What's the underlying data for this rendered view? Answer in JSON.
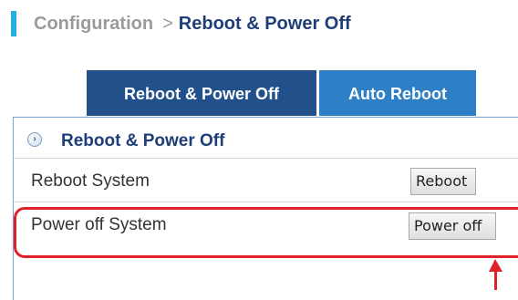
{
  "breadcrumb": {
    "section": "Configuration",
    "separator": ">",
    "current": "Reboot & Power Off"
  },
  "tabs": [
    {
      "label": "Reboot & Power Off",
      "active": true
    },
    {
      "label": "Auto Reboot",
      "active": false
    }
  ],
  "panel": {
    "title": "Reboot & Power Off",
    "icon": "expand-arrow-icon",
    "rows": [
      {
        "label": "Reboot System",
        "button": "Reboot"
      },
      {
        "label": "Power off System",
        "button": "Power off"
      }
    ]
  },
  "annotation": {
    "highlight_color": "#e0212b",
    "highlighted_row": "Power off System",
    "arrow_icon": "up-arrow-icon"
  },
  "colors": {
    "accent_bar": "#29aee2",
    "tab_active": "#21508a",
    "tab_inactive": "#2d7fc6",
    "title": "#1f3e78"
  }
}
